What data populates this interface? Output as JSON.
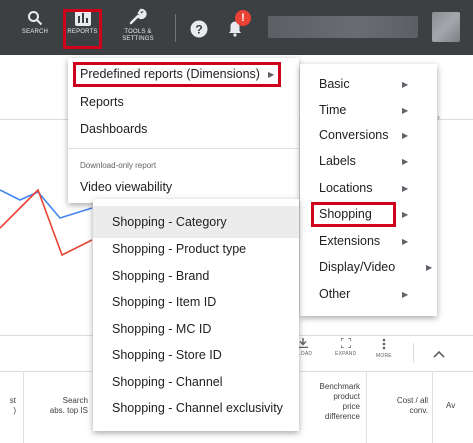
{
  "topbar": {
    "search_label": "SEARCH",
    "reports_label": "REPORTS",
    "tools_label_1": "TOOLS &",
    "tools_label_2": "SETTINGS",
    "notification_badge": "!"
  },
  "reports_menu": {
    "items": [
      {
        "label": "Predefined reports (Dimensions)"
      },
      {
        "label": "Reports"
      },
      {
        "label": "Dashboards"
      }
    ],
    "section_label": "Download-only report",
    "download_items": [
      {
        "label": "Video viewability"
      }
    ]
  },
  "dimensions_menu": {
    "items": [
      {
        "label": "Basic"
      },
      {
        "label": "Time"
      },
      {
        "label": "Conversions"
      },
      {
        "label": "Labels"
      },
      {
        "label": "Locations"
      },
      {
        "label": "Shopping"
      },
      {
        "label": "Extensions"
      },
      {
        "label": "Display/Video"
      },
      {
        "label": "Other"
      }
    ]
  },
  "shopping_menu": {
    "items": [
      {
        "label": "Shopping - Category"
      },
      {
        "label": "Shopping - Product type"
      },
      {
        "label": "Shopping - Brand"
      },
      {
        "label": "Shopping - Item ID"
      },
      {
        "label": "Shopping - MC ID"
      },
      {
        "label": "Shopping - Store ID"
      },
      {
        "label": "Shopping - Channel"
      },
      {
        "label": "Shopping - Channel exclusivity"
      }
    ]
  },
  "table_toolbar": {
    "download_label": "NLOAD",
    "expand_label": "EXPAND",
    "more_label": "MORE"
  },
  "table_headers": {
    "col_left_1": "st",
    "col_left_2": ")",
    "search_1": "Search",
    "search_2": "abs. top IS",
    "bench_1": "Benchmark",
    "bench_2": "product",
    "bench_3": "price",
    "bench_4": "difference",
    "cost_1": "Cost / all",
    "cost_2": "conv.",
    "av": "Av"
  },
  "colors": {
    "highlight": "#d0021b",
    "topbar": "#3c4043",
    "notification": "#ea4335",
    "chart_blue": "#4285f4",
    "chart_red": "#ea4335"
  }
}
